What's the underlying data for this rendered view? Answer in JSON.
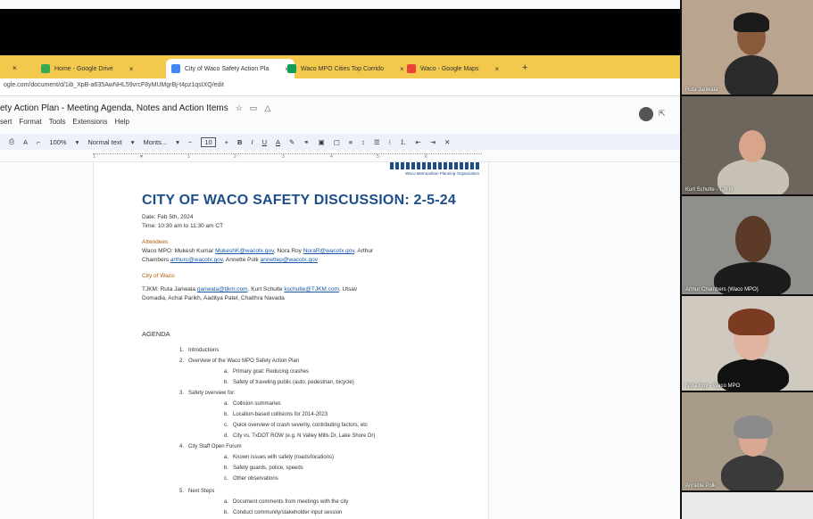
{
  "browser": {
    "tabs": [
      {
        "label": "Home - Google Drive",
        "active": false
      },
      {
        "label": "City of Waco Safety Action Pla",
        "active": true
      },
      {
        "label": "Waco MPO Cities Top Corrido",
        "active": false
      },
      {
        "label": "Waco - Google Maps",
        "active": false
      }
    ],
    "url": "ogle.com/document/d/1ib_XpB-a635AwNHL59vrcF8yMUMgrBj-t4pz1qsIXQ/edit"
  },
  "docs": {
    "title": "ety Action Plan - Meeting Agenda, Notes and Action Items",
    "menus": [
      "sert",
      "Format",
      "Tools",
      "Extensions",
      "Help"
    ],
    "toolbar": {
      "zoom": "100%",
      "style": "Normal text",
      "font": "Monts...",
      "font_size": "10"
    }
  },
  "document": {
    "logo_text": "Waco Metropolitan Planning Organization",
    "heading": "CITY OF WACO SAFETY DISCUSSION: 2-5-24",
    "date": "Date: Feb 5th, 2024",
    "time": "Time: 10:30 am to 11:30 am CT",
    "attendees_label": "Attendees",
    "attendees_line1_a": "Waco MPO:  Mukesh Kumar ",
    "attendees_email1": "MukeshK@wacotx.gov",
    "attendees_line1_b": ", Nora Roy ",
    "attendees_email2": "NoraR@wacotx.gov",
    "attendees_line1_c": ", Arthur",
    "attendees_line2_a": "Chambers ",
    "attendees_email3": "arthurc@wacotx.gov",
    "attendees_line2_b": ", Annette Polk ",
    "attendees_email4": "annettep@wacotx.gov",
    "city_label": "City of Waco",
    "tjkm_line1_a": "TJKM:  Ruta Jariwala ",
    "tjkm_email1": "rjariwala@tjkm.com",
    "tjkm_line1_b": ", Kurt Schulte ",
    "tjkm_email2": "kschulte@TJKM.com",
    "tjkm_line1_c": ", Utsav",
    "tjkm_line2": "Domadia, Achal Parikh, Aaditya Patel, Chaithra Navada",
    "agenda_title": "AGENDA",
    "agenda": [
      {
        "n": "1.",
        "text": "Introductions",
        "sub": []
      },
      {
        "n": "2.",
        "text": "Overview of the Waco MPO Safety Action Plan",
        "sub": [
          {
            "n": "a.",
            "text": "Primary goal: Reducing crashes"
          },
          {
            "n": "b.",
            "text": "Safety of traveling public (auto, pedestrian, bicycle)"
          }
        ]
      },
      {
        "n": "3.",
        "text": "Safety overview for:",
        "sub": [
          {
            "n": "a.",
            "text": "Collision summaries"
          },
          {
            "n": "b.",
            "text": "Location-based collisions for 2014-2023"
          },
          {
            "n": "c.",
            "text": "Quick overview of crash severity, contributing factors, etc"
          },
          {
            "n": "d.",
            "text": "City vs. TxDOT ROW (e.g. N Valley Mills Dr, Lake Shore Dr)"
          }
        ]
      },
      {
        "n": "4.",
        "text": "City Staff Open Forum",
        "sub": [
          {
            "n": "a.",
            "text": "Known issues with safety (roads/locations)"
          },
          {
            "n": "b.",
            "text": "Safety guards, police, speeds"
          },
          {
            "n": "c.",
            "text": "Other observations"
          }
        ]
      },
      {
        "n": "5.",
        "text": "Next Steps",
        "sub": [
          {
            "n": "a.",
            "text": "Document comments from meetings with the city"
          },
          {
            "n": "b.",
            "text": "Conduct community/stakeholder input session"
          }
        ]
      }
    ]
  },
  "participants": [
    {
      "name": "Ruta Jariwala"
    },
    {
      "name": "Kurt Schulte - TJKM"
    },
    {
      "name": "Arthur Chambers (Waco MPO)"
    },
    {
      "name": "Nora Roy - Waco MPO"
    },
    {
      "name": "Annette Polk"
    }
  ],
  "colors": {
    "tab_bar": "#f2c94c",
    "heading_blue": "#1d4e89",
    "attendee_orange": "#b35a00",
    "link_blue": "#1a57a8"
  }
}
